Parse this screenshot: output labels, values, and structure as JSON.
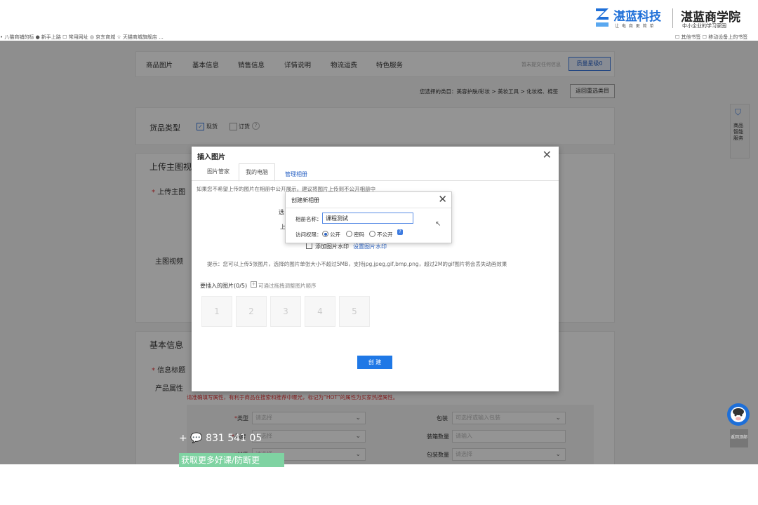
{
  "brand": {
    "name1": "湛蓝科技",
    "slogan1": "让 电 商 更 简 单",
    "name2": "湛蓝商学院",
    "slogan2": "中小企业的学习家园",
    "logo_color": "#1e6fd8"
  },
  "bookmarks": {
    "left": "• 八猫商铺的标   ● 新手上路   ☐ 常用网址   ◎ 京东商城   ☆ 天猫商城旗舰店 ...",
    "right": "☐ 其他书签   ☐ 移动设备上的书签"
  },
  "tabs": [
    "商品图片",
    "基本信息",
    "销售信息",
    "详情说明",
    "物流运费",
    "特色服务"
  ],
  "top_right": {
    "hint": "暂未提交任何信息",
    "quality_btn": "质量星级0"
  },
  "category": {
    "text": "您选择的类目：美容护肤/彩妆 > 美妆工具 > 化妆棉、棉签",
    "back_btn": "返回重选类目"
  },
  "goods_type": {
    "label": "货品类型",
    "opt1": "现货",
    "opt2": "订货"
  },
  "upload_section": {
    "title": "上传主图视",
    "main_image_label": "上传主图",
    "video_label": "主图视频"
  },
  "basic_section": {
    "title": "基本信息",
    "info_title_label": "信息标题",
    "attr_label": "产品属性",
    "hint": "请准确填写属性，有利于商品在搜索和推荐中曝光，标记为“HOT”的属性为买家热搜属性。",
    "fields": [
      {
        "label": "类型",
        "placeholder": "请选择"
      },
      {
        "label": "包装",
        "placeholder": "可选择或输入包装"
      },
      {
        "label": "品牌",
        "placeholder": "请选择"
      },
      {
        "label": "装箱数量",
        "placeholder": "请输入"
      },
      {
        "label": "材质",
        "placeholder": "请选择"
      },
      {
        "label": "包装数量",
        "placeholder": "请选择"
      }
    ]
  },
  "dialog": {
    "title": "插入图片",
    "tabs": [
      "图片管家",
      "我的电脑"
    ],
    "manage_link": "管理相册",
    "notice": "如果您不希望上传的图片在相册中公开展示，建议将图片上传到不公开相册中",
    "partial1": "选",
    "partial2": "上",
    "watermark_label": "添加图片水印",
    "watermark_link": "设置图片水印",
    "tip": "提示：您可以上传5张图片，选择的图片单张大小不超过5MB，支持jpg,jpeg,gif,bmp,png，超过2M的gif图片将会丢失动画效果",
    "to_insert": "要插入的图片(0/5)",
    "drag_hint": "可通过拖拽调整图片顺序",
    "slots": [
      "1",
      "2",
      "3",
      "4",
      "5"
    ],
    "create_btn": "创 建"
  },
  "sub_dialog": {
    "title": "创建新相册",
    "name_label": "相册名称：",
    "name_value": "课程测试",
    "access_label": "访问权限：",
    "options": [
      "公开",
      "密码",
      "不公开"
    ],
    "selected": "公开"
  },
  "side": {
    "service": "商品智能服务",
    "back_top": "返回顶部"
  },
  "overlay_text": {
    "contact": "+ 💬  831 541 05",
    "promo": "获取更多好课/防断更"
  }
}
